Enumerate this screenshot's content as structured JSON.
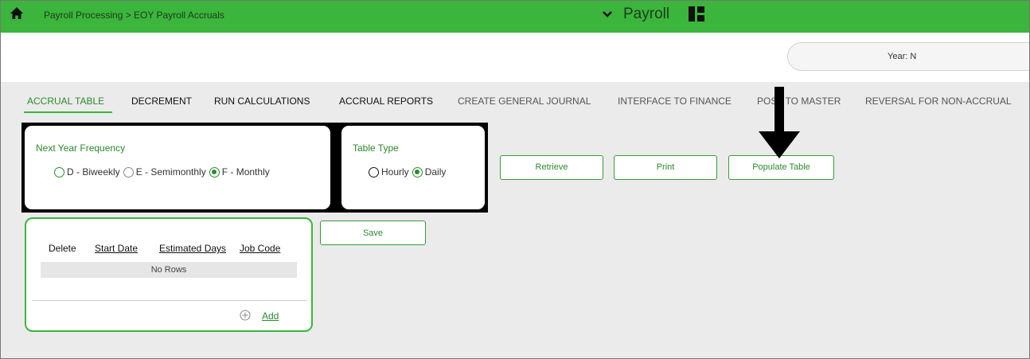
{
  "header": {
    "breadcrumb": "Payroll Processing > EOY Payroll Accruals",
    "module": "Payroll",
    "home_icon": "home-icon",
    "module_chevron_icon": "chevron-down-icon",
    "module_grid_icon": "grid-icon"
  },
  "year_bar": {
    "label": "Year: N"
  },
  "tabs": [
    {
      "label": "ACCRUAL TABLE"
    },
    {
      "label": "DECREMENT"
    },
    {
      "label": "RUN CALCULATIONS"
    },
    {
      "label": "ACCRUAL REPORTS"
    },
    {
      "label": "CREATE GENERAL JOURNAL"
    },
    {
      "label": "INTERFACE TO FINANCE"
    },
    {
      "label": "POST TO MASTER"
    },
    {
      "label": "REVERSAL FOR NON-ACCRUAL"
    }
  ],
  "next_year_frequency": {
    "title": "Next Year Frequency",
    "options": [
      {
        "label": "D - Biweekly",
        "selected": false
      },
      {
        "label": "E - Semimonthly",
        "selected": false
      },
      {
        "label": "F - Monthly",
        "selected": true
      }
    ]
  },
  "table_type": {
    "title": "Table Type",
    "options": [
      {
        "label": "Hourly",
        "selected": false
      },
      {
        "label": "Daily",
        "selected": true
      }
    ]
  },
  "buttons": {
    "retrieve": "Retrieve",
    "print": "Print",
    "populate": "Populate Table",
    "save": "Save"
  },
  "accrual_table": {
    "columns": [
      "Delete",
      "Start Date",
      "Estimated Days",
      "Job Code"
    ],
    "empty_text": "No Rows",
    "add_label": "Add"
  },
  "colors": {
    "header_green": "#3bb53b",
    "accent_green": "#2c8a2c",
    "background": "#ebebeb"
  }
}
